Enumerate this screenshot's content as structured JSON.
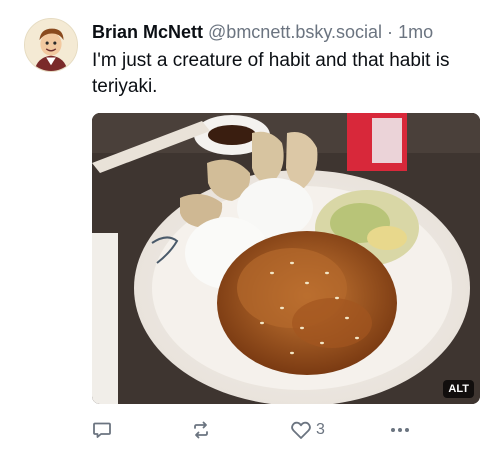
{
  "post": {
    "author_name": "Brian McNett",
    "handle": "@bmcnett.bsky.social",
    "separator": "·",
    "time": "1mo",
    "text": "I'm just a creature of habit and that habit is teriyaki.",
    "media": {
      "alt_badge": "ALT"
    },
    "actions": {
      "like_count": "3"
    }
  },
  "icons": {
    "reply": "speech-bubble-icon",
    "repost": "repost-arrows-icon",
    "like": "heart-icon",
    "more": "ellipsis-icon"
  },
  "colors": {
    "text": "#0b0f14",
    "muted": "#6b7480"
  }
}
